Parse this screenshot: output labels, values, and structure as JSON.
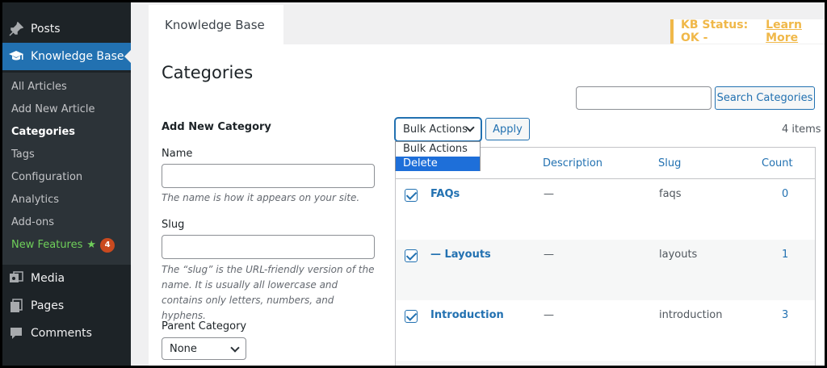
{
  "sidebar": {
    "top_items": [
      {
        "label": "Posts",
        "icon": "pin-icon"
      },
      {
        "label": "Knowledge Base",
        "icon": "graduation-cap-icon"
      }
    ],
    "submenu": [
      {
        "label": "All Articles"
      },
      {
        "label": "Add New Article"
      },
      {
        "label": "Categories"
      },
      {
        "label": "Tags"
      },
      {
        "label": "Configuration"
      },
      {
        "label": "Analytics"
      },
      {
        "label": "Add-ons"
      }
    ],
    "new_features": {
      "label": "New Features",
      "badge": "4"
    },
    "bottom_items": [
      {
        "label": "Media",
        "icon": "media-icon"
      },
      {
        "label": "Pages",
        "icon": "pages-icon"
      },
      {
        "label": "Comments",
        "icon": "comment-icon"
      }
    ]
  },
  "header": {
    "tab_label": "Knowledge Base",
    "status_text": "KB Status: OK -",
    "status_link": "Learn More"
  },
  "main": {
    "title": "Categories",
    "search_button": "Search Categories",
    "search_value": ""
  },
  "form": {
    "heading": "Add New Category",
    "name_label": "Name",
    "name_hint": "The name is how it appears on your site.",
    "slug_label": "Slug",
    "slug_hint": "The “slug” is the URL-friendly version of the name. It is usually all lowercase and contains only letters, numbers, and hyphens.",
    "parent_label": "Parent Category",
    "parent_value": "None"
  },
  "bulk": {
    "selected": "Bulk Actions",
    "options": [
      "Bulk Actions",
      "Delete"
    ],
    "highlighted": "Delete",
    "apply_label": "Apply",
    "items_count": "4 items"
  },
  "table": {
    "columns": [
      "Description",
      "Slug",
      "Count"
    ],
    "rows": [
      {
        "name": "FAQs",
        "description": "—",
        "slug": "faqs",
        "count": "0",
        "checked": true
      },
      {
        "name": "— Layouts",
        "description": "—",
        "slug": "layouts",
        "count": "1",
        "checked": true
      },
      {
        "name": "Introduction",
        "description": "—",
        "slug": "introduction",
        "count": "3",
        "checked": true
      }
    ]
  },
  "colors": {
    "sidebar_bg": "#1d2327",
    "submenu_bg": "#2c3338",
    "active_blue": "#2271b1",
    "status_orange": "#f0b849",
    "new_features_green": "#6fcf5a"
  }
}
